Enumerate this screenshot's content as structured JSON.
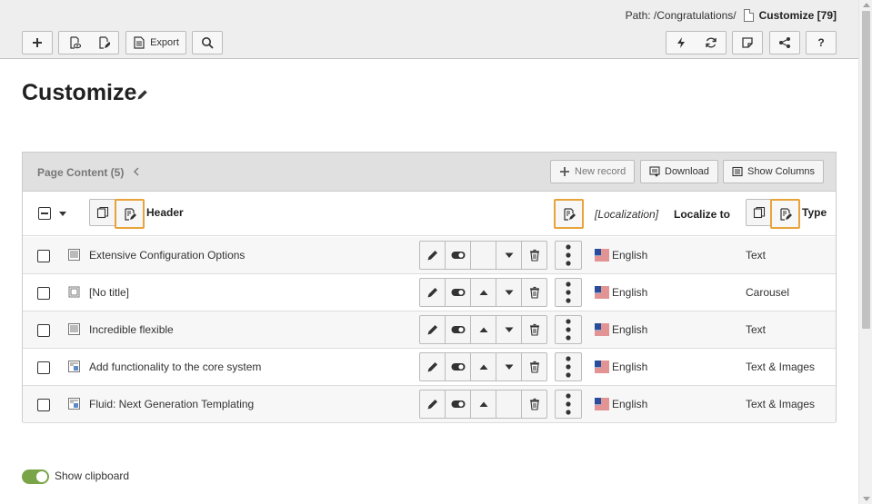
{
  "path": {
    "prefix": "Path: /Congratulations/",
    "page": "Customize [79]"
  },
  "toolbar": {
    "export_label": "Export"
  },
  "page": {
    "title": "Customize"
  },
  "panel": {
    "title": "Page Content (5)",
    "new_record_label": "New record",
    "download_label": "Download",
    "show_columns_label": "Show Columns"
  },
  "columns": {
    "header": "Header",
    "localization": "[Localization]",
    "localize_to": "Localize to",
    "type": "Type"
  },
  "rows": [
    {
      "title": "Extensive Configuration Options",
      "language": "English",
      "type": "Text",
      "icon": "text-content-icon"
    },
    {
      "title": "[No title]",
      "language": "English",
      "type": "Carousel",
      "icon": "carousel-content-icon"
    },
    {
      "title": "Incredible flexible",
      "language": "English",
      "type": "Text",
      "icon": "text-content-icon"
    },
    {
      "title": "Add functionality to the core system",
      "language": "English",
      "type": "Text & Images",
      "icon": "text-images-content-icon"
    },
    {
      "title": "Fluid: Next Generation Templating",
      "language": "English",
      "type": "Text & Images",
      "icon": "text-images-content-icon"
    }
  ],
  "clipboard": {
    "label": "Show clipboard",
    "enabled": true
  },
  "colors": {
    "highlight": "#e8a33a",
    "toggle_on": "#79a548"
  }
}
